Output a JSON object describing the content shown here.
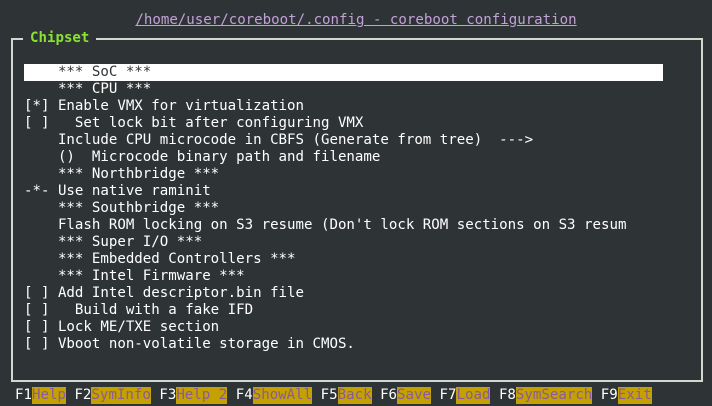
{
  "window_title": "/home/user/coreboot/.config - coreboot configuration",
  "section_title": "Chipset",
  "menu_items": [
    "    *** SoC ***",
    "    *** CPU ***",
    "[*] Enable VMX for virtualization",
    "[ ]   Set lock bit after configuring VMX",
    "    Include CPU microcode in CBFS (Generate from tree)  --->",
    "    ()  Microcode binary path and filename",
    "    *** Northbridge ***",
    "-*- Use native raminit",
    "    *** Southbridge ***",
    "    Flash ROM locking on S3 resume (Don't lock ROM sections on S3 resum",
    "    *** Super I/O ***",
    "    *** Embedded Controllers ***",
    "    *** Intel Firmware ***",
    "[ ] Add Intel descriptor.bin file",
    "[ ]   Build with a fake IFD",
    "[ ] Lock ME/TXE section",
    "[ ] Vboot non-volatile storage in CMOS."
  ],
  "selected_index": 0,
  "footer_keys": [
    {
      "key": "F1",
      "label": "Help"
    },
    {
      "key": "F2",
      "label": "SymInfo"
    },
    {
      "key": "F3",
      "label": "Help 2"
    },
    {
      "key": "F4",
      "label": "ShowAll"
    },
    {
      "key": "F5",
      "label": "Back"
    },
    {
      "key": "F6",
      "label": "Save"
    },
    {
      "key": "F7",
      "label": "Load"
    },
    {
      "key": "F8",
      "label": "SymSearch"
    },
    {
      "key": "F9",
      "label": "Exit"
    }
  ],
  "colors": {
    "background": "#2e3436",
    "title": "#c4a0d8",
    "section_title": "#8ae234",
    "footer_label_bg": "#c4a000"
  }
}
